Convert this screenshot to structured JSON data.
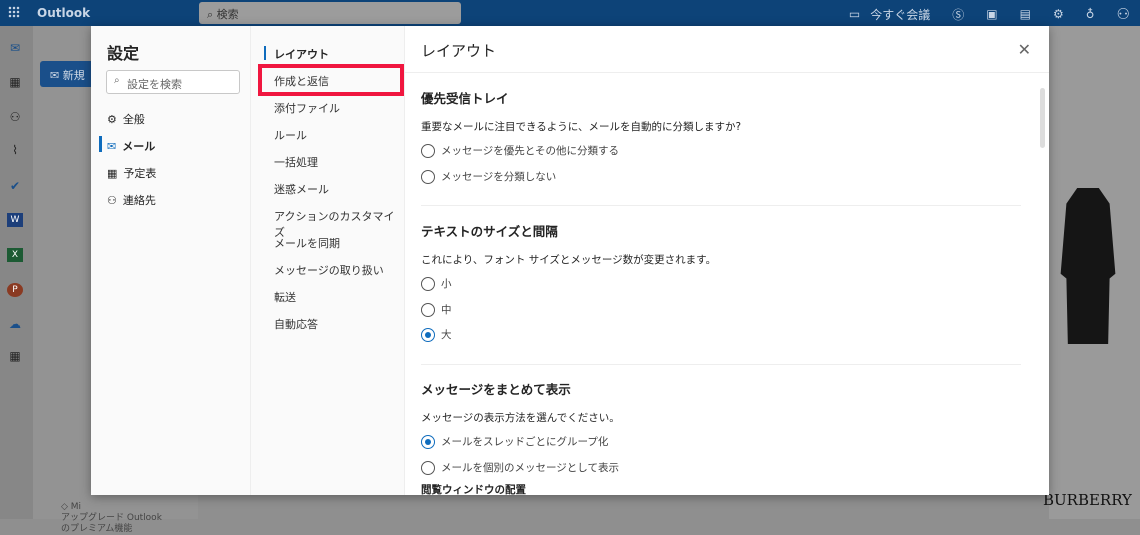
{
  "topbar": {
    "app_name": "Outlook",
    "search_placeholder": "検索",
    "meet_now": "今すぐ会議",
    "icons": [
      "video-icon",
      "skype-icon",
      "office-icon",
      "calendar-check-icon",
      "gear-icon",
      "lightbulb-icon",
      "user-icon"
    ]
  },
  "nav": {
    "new_mail": "新規",
    "premium_line1": "Mi",
    "premium_line2": "アップグレード Outlook",
    "premium_line3": "のプレミアム機能"
  },
  "ad": {
    "brand": "BURBERRY"
  },
  "settings": {
    "title": "設定",
    "search_placeholder": "設定を検索",
    "categories": [
      {
        "label": "全般",
        "icon": "gear-icon"
      },
      {
        "label": "メール",
        "icon": "mail-icon",
        "selected": true
      },
      {
        "label": "予定表",
        "icon": "calendar-icon"
      },
      {
        "label": "連絡先",
        "icon": "people-icon"
      }
    ],
    "subcategories": [
      "レイアウト",
      "作成と返信",
      "添付ファイル",
      "ルール",
      "一括処理",
      "迷惑メール",
      "アクションのカスタマイズ",
      "メールを同期",
      "メッセージの取り扱い",
      "転送",
      "自動応答"
    ],
    "highlight_color": "#f0163f",
    "content": {
      "title": "レイアウト",
      "sections": [
        {
          "heading": "優先受信トレイ",
          "description": "重要なメールに注目できるように、メールを自動的に分類しますか?",
          "options": [
            {
              "label": "メッセージを優先とその他に分類する",
              "checked": false
            },
            {
              "label": "メッセージを分類しない",
              "checked": false
            }
          ]
        },
        {
          "heading": "テキストのサイズと間隔",
          "description": "これにより、フォント サイズとメッセージ数が変更されます。",
          "options": [
            {
              "label": "小",
              "checked": false
            },
            {
              "label": "中",
              "checked": false
            },
            {
              "label": "大",
              "checked": true
            }
          ]
        },
        {
          "heading": "メッセージをまとめて表示",
          "description": "メッセージの表示方法を選んでください。",
          "options": [
            {
              "label": "メールをスレッドごとにグループ化",
              "checked": true
            },
            {
              "label": "メールを個別のメッセージとして表示",
              "checked": false
            }
          ]
        }
      ],
      "next_heading": "閲覧ウィンドウの配置"
    }
  }
}
